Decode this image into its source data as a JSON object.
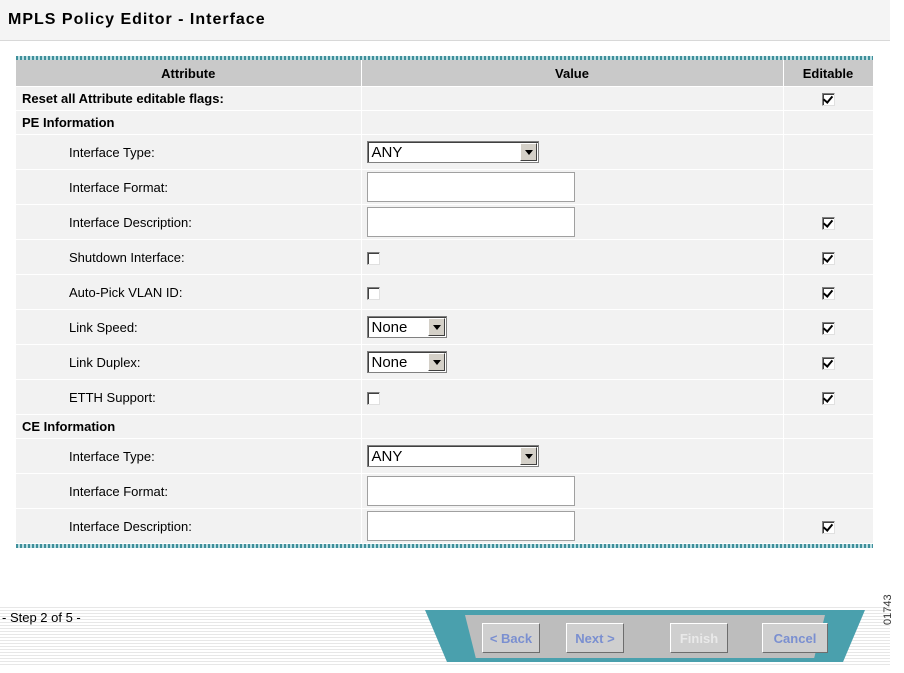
{
  "page": {
    "title": "MPLS Policy Editor - Interface",
    "side_code": "01743"
  },
  "table": {
    "headers": {
      "attribute": "Attribute",
      "value": "Value",
      "editable": "Editable"
    },
    "reset_row": {
      "label": "Reset all Attribute editable flags:",
      "editable": true
    },
    "pe_section": "PE Information",
    "ce_section": "CE Information",
    "pe_rows": [
      {
        "label": "Interface Type:",
        "control": "select",
        "value": "ANY",
        "editable": null
      },
      {
        "label": "Interface Format:",
        "control": "text",
        "value": "",
        "editable": null
      },
      {
        "label": "Interface Description:",
        "control": "text",
        "value": "",
        "editable": true
      },
      {
        "label": "Shutdown Interface:",
        "control": "checkbox",
        "checked": false,
        "editable": true
      },
      {
        "label": "Auto-Pick VLAN ID:",
        "control": "checkbox",
        "checked": false,
        "editable": true
      },
      {
        "label": "Link Speed:",
        "control": "select",
        "value": "None",
        "editable": true
      },
      {
        "label": "Link Duplex:",
        "control": "select",
        "value": "None",
        "editable": true
      },
      {
        "label": "ETTH Support:",
        "control": "checkbox",
        "checked": false,
        "editable": true
      }
    ],
    "ce_rows": [
      {
        "label": "Interface Type:",
        "control": "select",
        "value": "ANY",
        "editable": null
      },
      {
        "label": "Interface Format:",
        "control": "text",
        "value": "",
        "editable": null
      },
      {
        "label": "Interface Description:",
        "control": "text",
        "value": "",
        "editable": true
      }
    ]
  },
  "footer": {
    "step": "- Step 2 of 5 -",
    "buttons": {
      "back": "< Back",
      "next": "Next >",
      "finish": "Finish",
      "cancel": "Cancel"
    },
    "finish_enabled": false
  },
  "colors": {
    "accent": "#4aa0ad",
    "header_bg": "#c9c9c9",
    "row_bg": "#f2f2f2",
    "button_text": "#7a8fd0"
  }
}
